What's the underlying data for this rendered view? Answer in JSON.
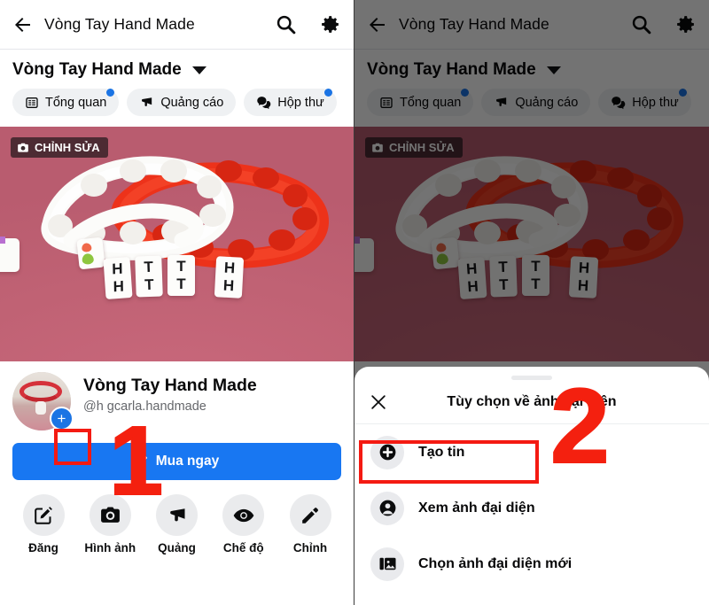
{
  "app": {
    "appbar": {
      "back_icon": "arrow-left-icon",
      "title": "Vòng Tay Hand Made",
      "search_icon": "search-icon",
      "settings_icon": "gear-icon"
    },
    "page_header": {
      "name": "Vòng Tay Hand Made",
      "caret_icon": "chevron-down-icon"
    },
    "chips": [
      {
        "label": "Tổng quan",
        "icon": "list-icon",
        "badge": true
      },
      {
        "label": "Quảng cáo",
        "icon": "megaphone-icon",
        "badge": false
      },
      {
        "label": "Hộp thư",
        "icon": "messages-icon",
        "badge": true
      }
    ],
    "cover": {
      "edit_label": "CHỈNH SỬA",
      "edit_icon": "camera-icon",
      "bead_letters": [
        "H",
        "T",
        "T",
        "H"
      ],
      "bead_letters_bottom": [
        "H",
        "T",
        "T",
        "H"
      ]
    },
    "profile": {
      "avatar_name": "avatar",
      "add_story_icon": "plus-icon",
      "name": "Vòng Tay Hand Made",
      "handle": "@h      gcarla.handmade",
      "cta_label": "Mua ngay",
      "cta_icon": "pencil-icon"
    },
    "actions": [
      {
        "label": "Đăng",
        "icon": "compose-icon"
      },
      {
        "label": "Hình ảnh",
        "icon": "camera-icon"
      },
      {
        "label": "Quảng",
        "icon": "megaphone-icon"
      },
      {
        "label": "Chế độ",
        "icon": "eye-icon"
      },
      {
        "label": "Chỉnh",
        "icon": "pencil-icon"
      }
    ]
  },
  "sheet": {
    "close_icon": "close-icon",
    "title": "Tùy chọn về ảnh đại diện",
    "items": [
      {
        "label": "Tạo tin",
        "icon": "plus-circle-icon"
      },
      {
        "label": "Xem ảnh đại diện",
        "icon": "person-circle-icon"
      },
      {
        "label": "Chọn ảnh đại diện mới",
        "icon": "photo-stack-icon"
      }
    ]
  },
  "annotations": {
    "step_one": "1",
    "step_two": "2",
    "accent": "#f4200f"
  },
  "colors": {
    "facebook_blue": "#1877f2",
    "badge_blue": "#1b74e4",
    "chip_bg": "#eff1f3",
    "cover_pink": "#c26274",
    "annotation_red": "#f4200f"
  }
}
